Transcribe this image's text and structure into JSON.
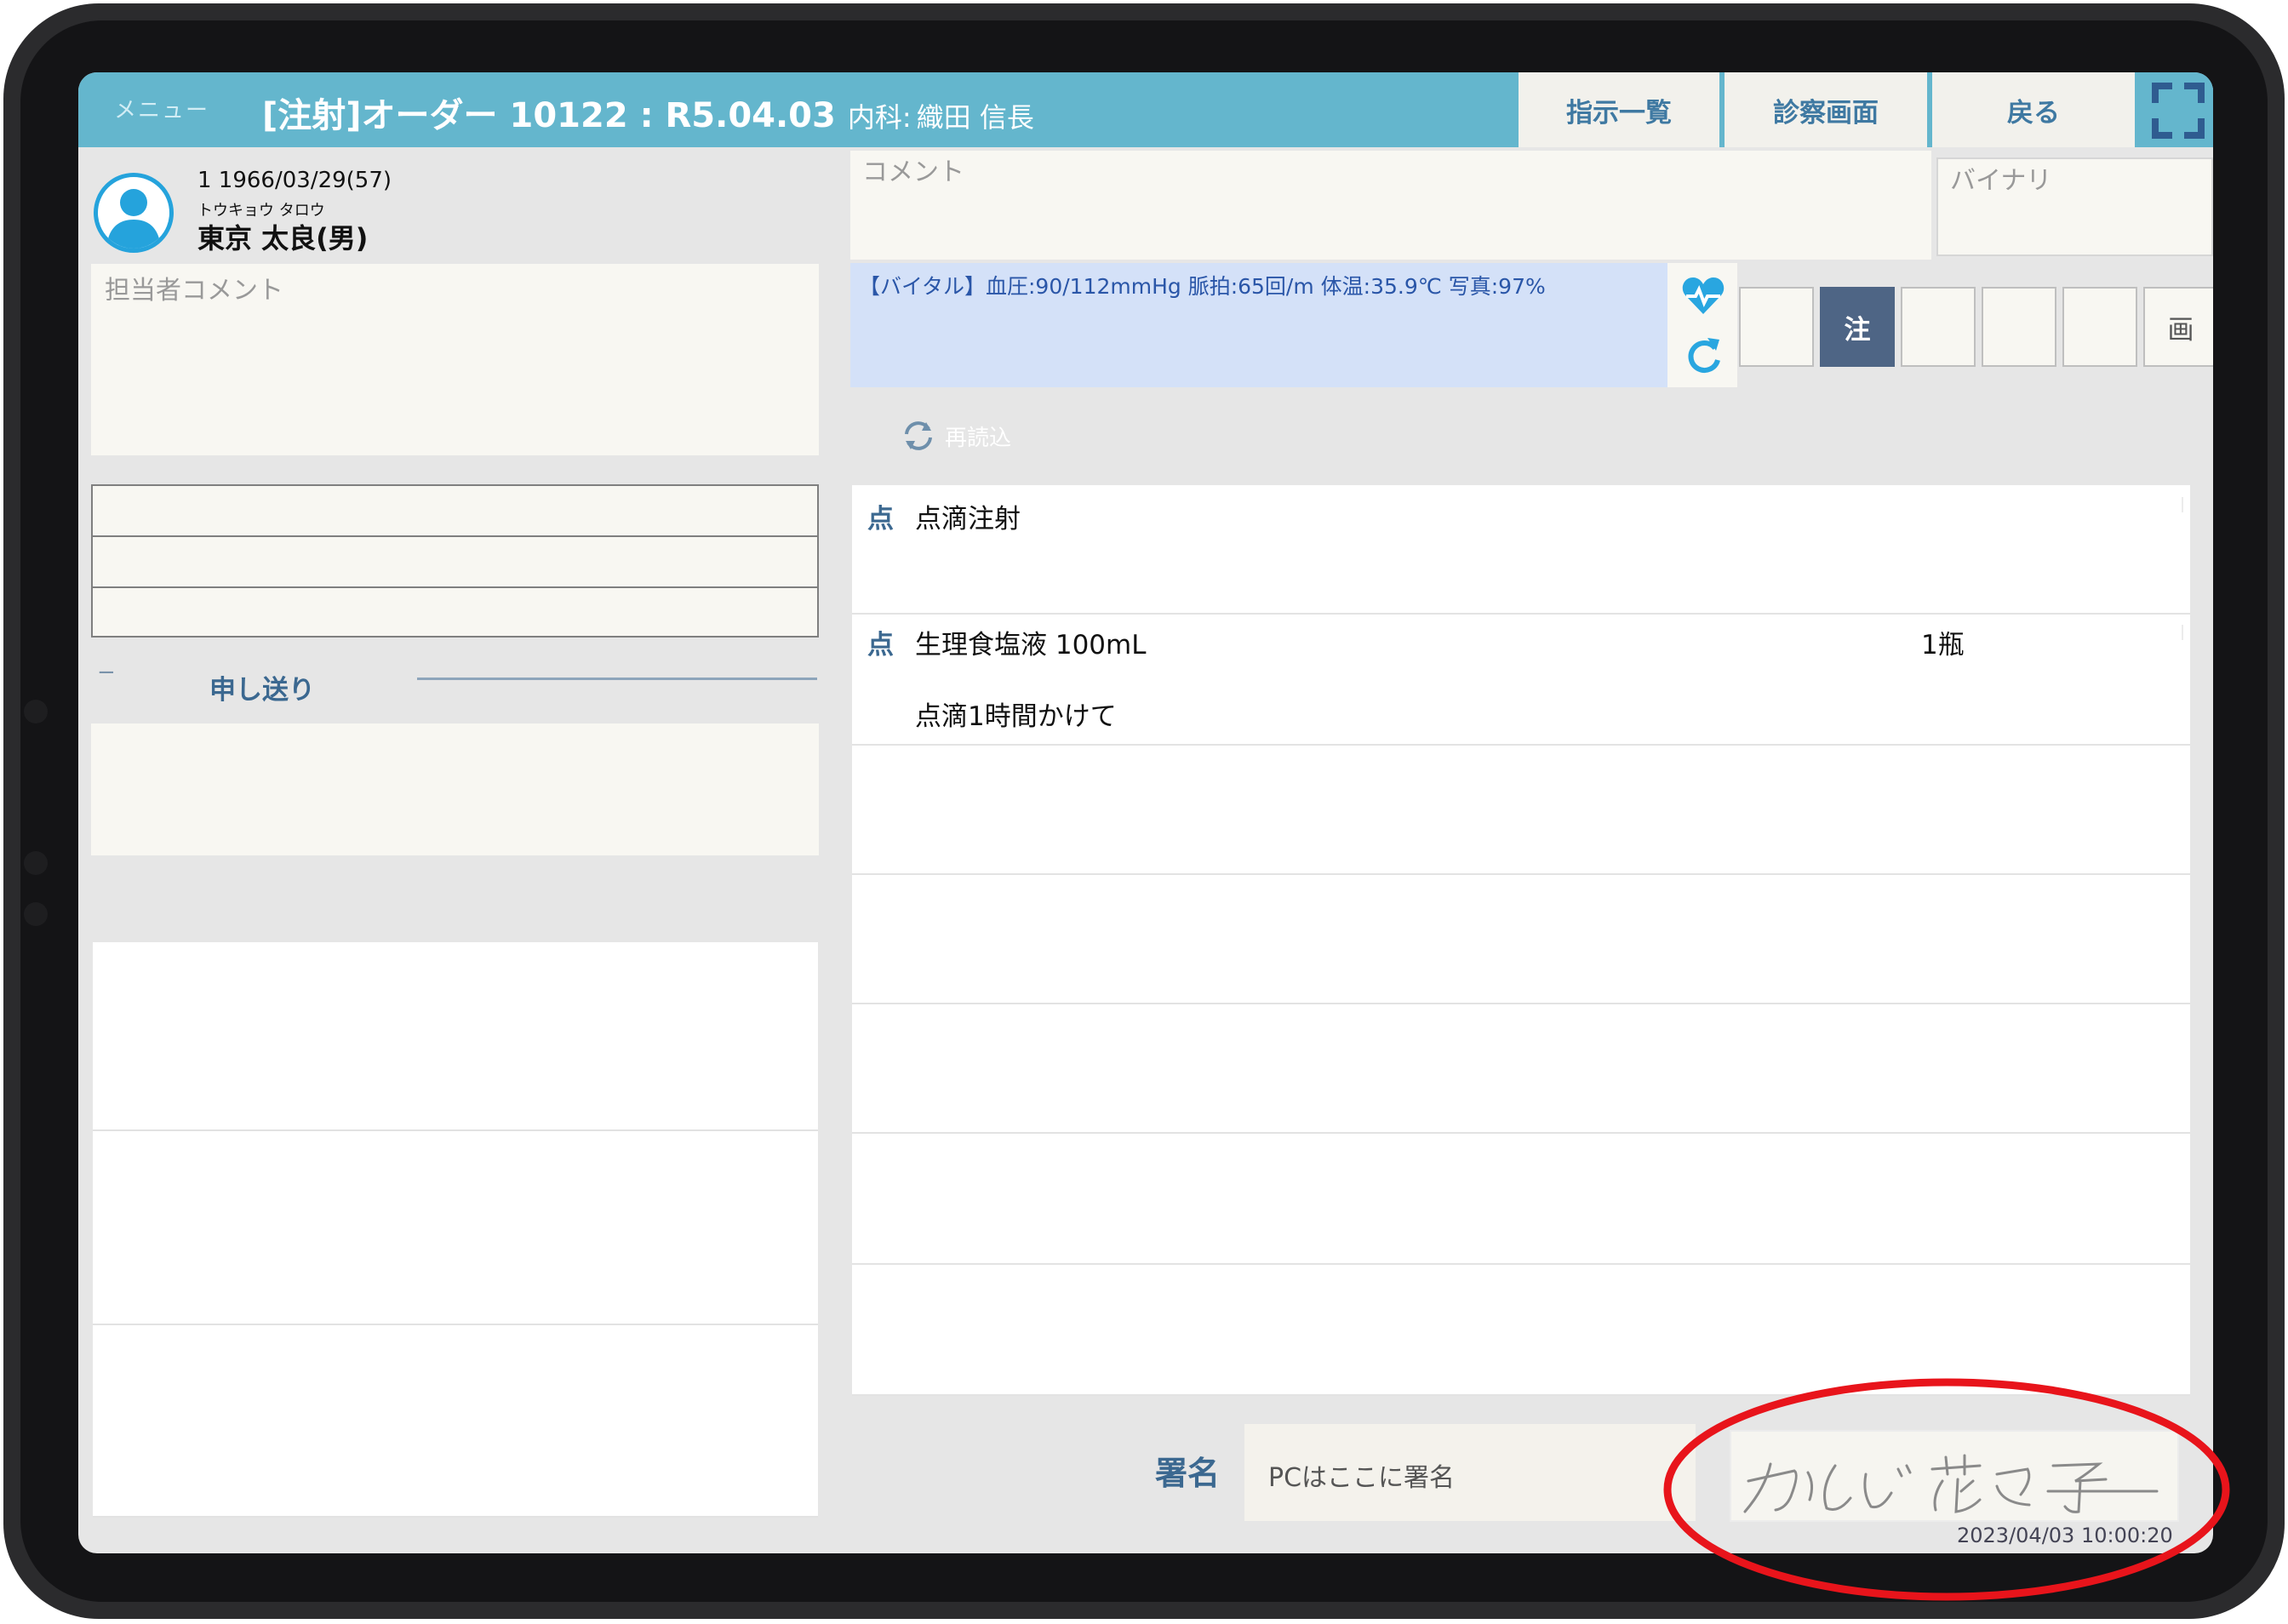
{
  "header": {
    "menu_label": "メニュー",
    "title": "[注射]オーダー 10122 : R5.04.03",
    "department": "内科:",
    "doctor": "織田 信長",
    "buttons": [
      "指示一覧",
      "診察画面",
      "戻る"
    ]
  },
  "patient": {
    "line1": "1  1966/03/29(57)",
    "kana": "トウキョウ タロウ",
    "name": "東京 太良(男)"
  },
  "staff_comment": {
    "placeholder": "担当者コメント"
  },
  "handoff": {
    "label": "申し送り",
    "dash": "−"
  },
  "comment": {
    "placeholder": "コメント"
  },
  "binary": {
    "placeholder": "バイナリ"
  },
  "vitals": {
    "text": "【バイタル】血圧:90/112mmHg 脈拍:65回/m 体温:35.9℃ 写真:97%"
  },
  "categories": [
    {
      "label": "",
      "active": false
    },
    {
      "label": "注",
      "active": true
    },
    {
      "label": "",
      "active": false
    },
    {
      "label": "",
      "active": false
    },
    {
      "label": "",
      "active": false
    },
    {
      "label": "画",
      "active": false
    }
  ],
  "reload_label": "再読込",
  "orders": [
    {
      "tag": "点",
      "name": "点滴注射",
      "qty": "",
      "note": ""
    },
    {
      "tag": "点",
      "name": "生理食塩液 100mL",
      "qty": "1瓶",
      "note": "点滴1時間かけて"
    }
  ],
  "signature": {
    "label": "署名",
    "pc_placeholder": "PCはここに署名",
    "timestamp": "2023/04/03 10:00:20"
  },
  "colors": {
    "header_bg": "#64b6cd",
    "accent_text": "#3b6890",
    "vital_bg": "#d4e1f8",
    "active_category": "#4e6585",
    "annotation_circle": "#e8141b"
  },
  "icons": [
    "expand-icon",
    "avatar-icon",
    "heart-pulse-icon",
    "refresh-icon",
    "reload-icon"
  ]
}
